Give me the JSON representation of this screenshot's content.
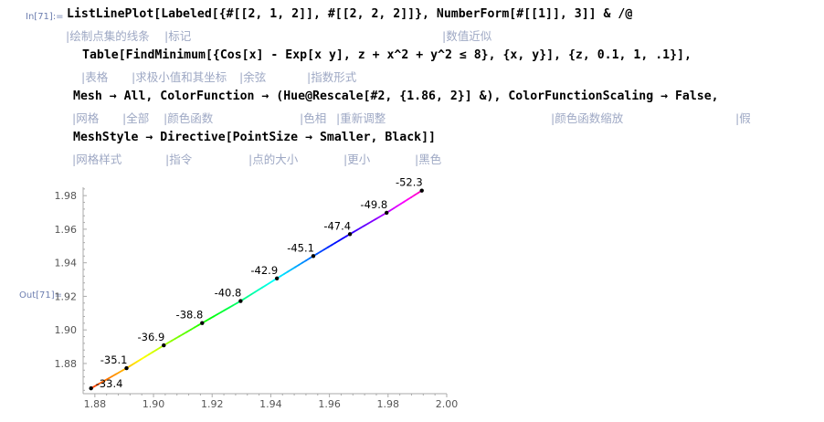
{
  "cell": {
    "in_label": "In[71]:=",
    "out_label": "Out[71]="
  },
  "code_lines": [
    "ListLinePlot[Labeled[{#[[2, 1, 2]], #[[2, 2, 2]]}, NumberForm[#[[1]], 3]] & /@",
    "Table[FindMinimum[{Cos[x] - Exp[x y], z + x^2 + y^2 ≤ 8}, {x, y}], {z, 0.1, 1, .1}],",
    "Mesh → All, ColorFunction → (Hue@Rescale[#2, {1.86, 2}] &), ColorFunctionScaling → False,",
    "MeshStyle → Directive[PointSize → Smaller, Black]]"
  ],
  "hints": [
    [
      "|绘制点集的线条",
      "|标记",
      "|数值近似"
    ],
    [
      "|表格",
      "|求极小值和其坐标",
      "|余弦",
      "|指数形式"
    ],
    [
      "|网格",
      "|全部",
      "|颜色函数",
      "|色相",
      "|重新调整",
      "|颜色函数缩放",
      "|假"
    ],
    [
      "|网格样式",
      "|指令",
      "|点的大小",
      "|更小",
      "|黑色"
    ]
  ],
  "chart_data": {
    "type": "line",
    "x": [
      1.8787,
      1.8908,
      1.9035,
      1.9166,
      1.9297,
      1.9421,
      1.9545,
      1.967,
      1.9795,
      1.9915
    ],
    "y": [
      1.8652,
      1.8772,
      1.8908,
      1.9041,
      1.9172,
      1.9307,
      1.944,
      1.9571,
      1.9698,
      1.983
    ],
    "point_labels": [
      "-33.4",
      "-35.1",
      "-36.9",
      "-38.8",
      "-40.8",
      "-42.9",
      "-45.1",
      "-47.4",
      "-49.8",
      "-52.3"
    ],
    "x_ticks": [
      "1.88",
      "1.90",
      "1.92",
      "1.94",
      "1.96",
      "1.98",
      "2.00"
    ],
    "y_ticks": [
      "1.88",
      "1.90",
      "1.92",
      "1.94",
      "1.96",
      "1.98"
    ],
    "xlim": [
      1.876,
      2.0
    ],
    "ylim": [
      1.862,
      1.985
    ],
    "color_function": "Hue rescaled on y from 1.86 to 2",
    "mesh": "All",
    "mesh_color": "#000000",
    "xlabel": "",
    "ylabel": "",
    "title": ""
  }
}
